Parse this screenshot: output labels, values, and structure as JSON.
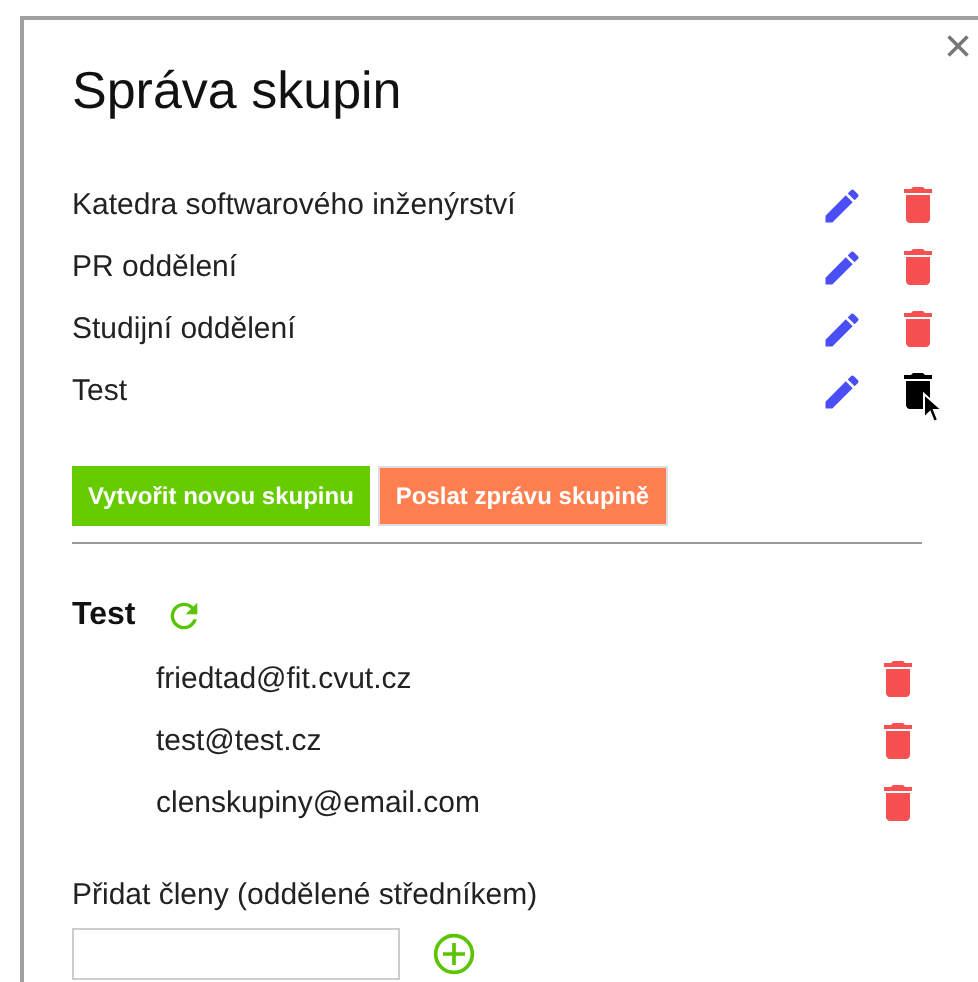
{
  "dialog": {
    "title": "Správa skupin",
    "close": "×"
  },
  "groups": [
    {
      "name": "Katedra softwarového inženýrství",
      "hovered": false
    },
    {
      "name": "PR oddělení",
      "hovered": false
    },
    {
      "name": "Studijní oddělení",
      "hovered": false
    },
    {
      "name": "Test",
      "hovered": true
    }
  ],
  "buttons": [
    {
      "label": "Vytvořit novou skupinu",
      "kind": "create"
    },
    {
      "label": "Poslat zprávu skupině",
      "kind": "message"
    }
  ],
  "selected_group": {
    "name": "Test",
    "members": [
      "friedtad@fit.cvut.cz",
      "test@test.cz",
      "clenskupiny@email.com"
    ]
  },
  "add_members": {
    "label": "Přidat členy (oddělené středníkem)"
  }
}
